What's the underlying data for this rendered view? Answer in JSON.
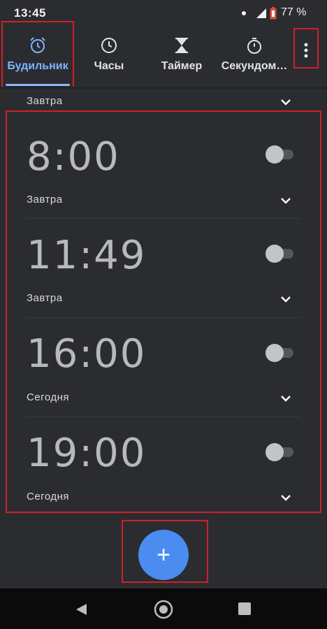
{
  "status_bar": {
    "time": "13:45",
    "battery": "77 %"
  },
  "tabs": [
    {
      "label": "Будильник",
      "icon": "alarm-clock-icon",
      "active": true
    },
    {
      "label": "Часы",
      "icon": "clock-icon",
      "active": false
    },
    {
      "label": "Таймер",
      "icon": "hourglass-icon",
      "active": false
    },
    {
      "label": "Секундом…",
      "icon": "stopwatch-icon",
      "active": false
    }
  ],
  "previous_alarm": {
    "day": "Завтра"
  },
  "alarms": [
    {
      "time": "8:00",
      "day": "Завтра",
      "enabled": false
    },
    {
      "time": "11:49",
      "day": "Завтра",
      "enabled": false
    },
    {
      "time": "16:00",
      "day": "Сегодня",
      "enabled": false
    },
    {
      "time": "19:00",
      "day": "Сегодня",
      "enabled": false
    }
  ],
  "fab": {
    "label": "+"
  },
  "colors": {
    "background": "#2b2c30",
    "accent": "#4b8cf0",
    "active_tab": "#7ab4ff",
    "highlight_box": "#d0202a"
  }
}
